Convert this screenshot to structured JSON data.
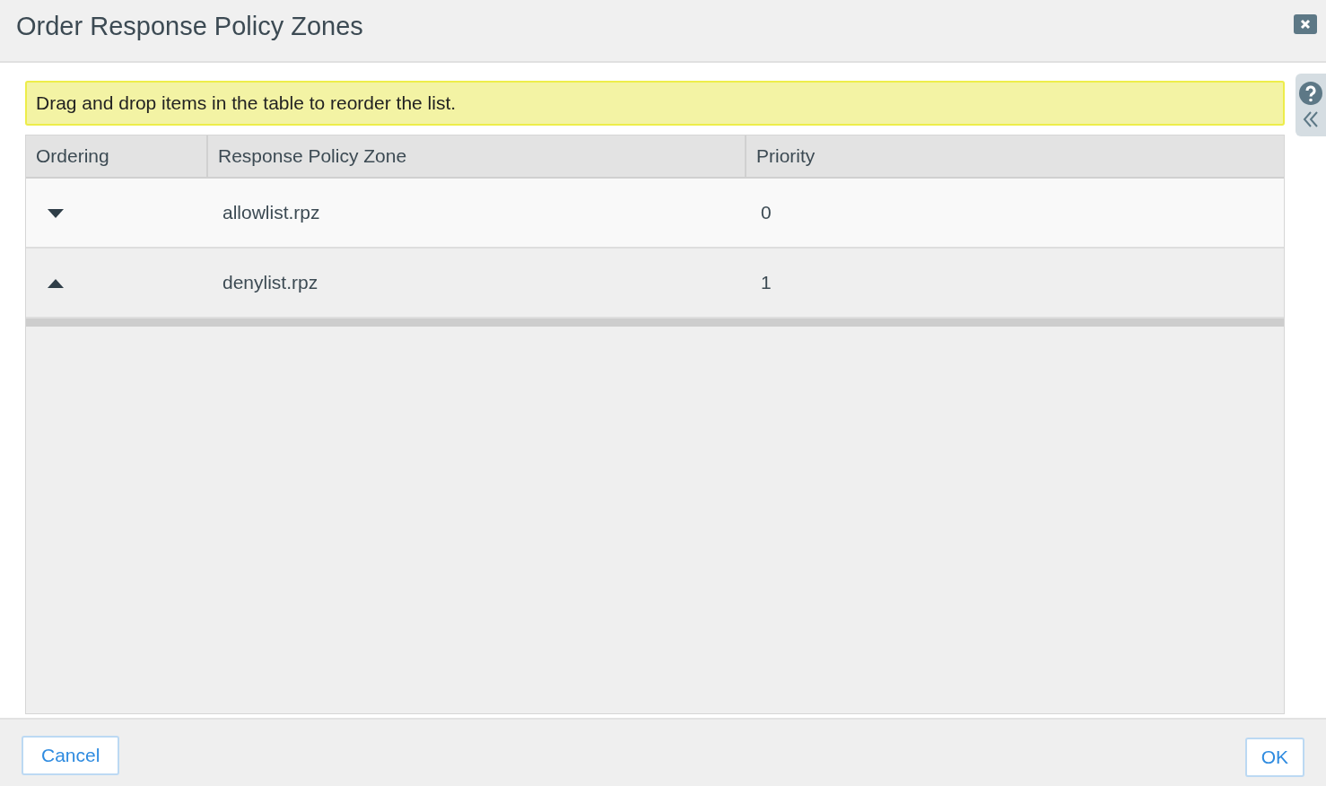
{
  "dialog": {
    "title": "Order Response Policy Zones"
  },
  "notice": "Drag and drop items in the table to reorder the list.",
  "table": {
    "columns": [
      "Ordering",
      "Response Policy Zone",
      "Priority"
    ],
    "rows": [
      {
        "kind": "down",
        "zone": "allowlist.rpz",
        "priority": "0"
      },
      {
        "kind": "up",
        "zone": "denylist.rpz",
        "priority": "1"
      }
    ]
  },
  "buttons": {
    "cancel": "Cancel",
    "ok": "OK"
  }
}
